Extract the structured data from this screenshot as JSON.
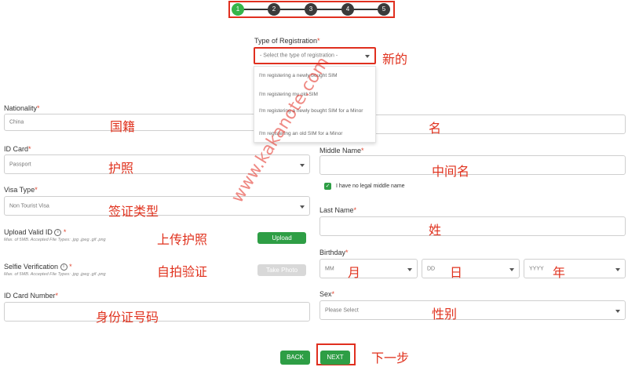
{
  "stepper": {
    "steps": [
      "1",
      "2",
      "3",
      "4",
      "5"
    ],
    "active": "1"
  },
  "registration": {
    "label": "Type of Registration",
    "placeholder": "- Select the type of registration -",
    "annotation": "新的",
    "options": [
      "I'm registering a newly bought SIM",
      "I'm registering my old SIM",
      "I'm registering a newly bought SIM for a Minor",
      "I'm registering an old SIM for a Minor"
    ]
  },
  "left": {
    "nationality": {
      "label": "Nationality",
      "value": "China",
      "annotation": "国籍"
    },
    "id_card": {
      "label": "ID Card",
      "value": "Passport",
      "annotation": "护照"
    },
    "visa_type": {
      "label": "Visa Type",
      "value": "Non Tourist Visa",
      "annotation": "签证类型"
    },
    "upload_id": {
      "label": "Upload Valid ID",
      "hint": "Max. of 5MB. Accepted File Types: .jpg .jpeg .gif .png",
      "button": "Upload",
      "annotation": "上传护照"
    },
    "selfie": {
      "label": "Selfie Verification",
      "hint": "Max. of 5MB. Accepted File Types: .jpg .jpeg .gif .png",
      "button": "Take Photo",
      "annotation": "自拍验证"
    },
    "id_number": {
      "label": "ID Card Number",
      "annotation": "身份证号码"
    }
  },
  "right": {
    "first_name": {
      "annotation": "名"
    },
    "middle_name": {
      "label": "Middle Name",
      "annotation": "中间名",
      "checkbox": "I have no legal middle name"
    },
    "last_name": {
      "label": "Last Name",
      "annotation": "姓"
    },
    "birthday": {
      "label": "Birthday",
      "month": "MM",
      "day": "DD",
      "year": "YYYY",
      "month_cn": "月",
      "day_cn": "日",
      "year_cn": "年"
    },
    "sex": {
      "label": "Sex",
      "value": "Please Select",
      "annotation": "性别"
    }
  },
  "footer": {
    "back": "BACK",
    "next": "NEXT",
    "annotation": "下一步"
  },
  "icons": {
    "info": "i",
    "caret": "caret-down-icon",
    "check": "✓"
  },
  "watermark": "www.kakanote.com",
  "colors": {
    "accent_green": "#2e9e45",
    "step_active": "#35b54a",
    "annotation_red": "#e0321e"
  }
}
